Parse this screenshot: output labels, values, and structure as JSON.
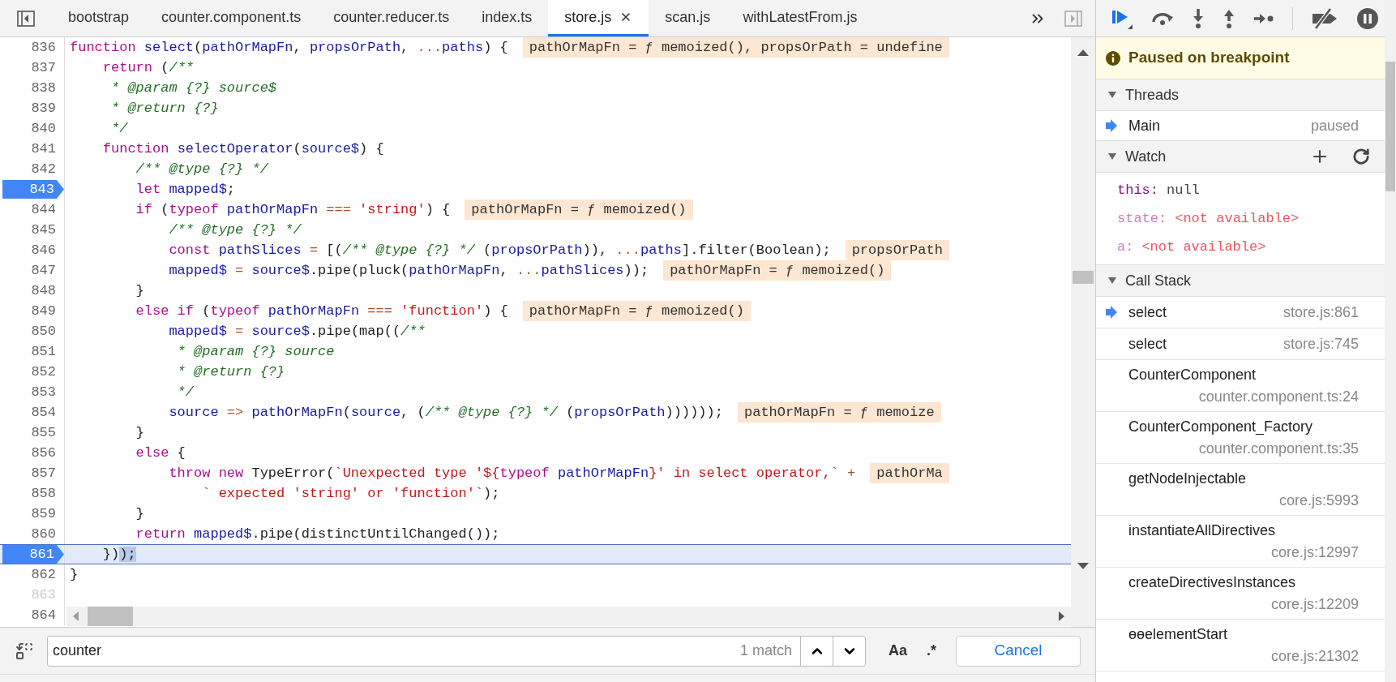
{
  "tabs": [
    {
      "label": "bootstrap",
      "selected": false,
      "closable": false
    },
    {
      "label": "counter.component.ts",
      "selected": false,
      "closable": false
    },
    {
      "label": "counter.reducer.ts",
      "selected": false,
      "closable": false
    },
    {
      "label": "index.ts",
      "selected": false,
      "closable": false
    },
    {
      "label": "store.js",
      "selected": true,
      "closable": true
    },
    {
      "label": "scan.js",
      "selected": false,
      "closable": false
    },
    {
      "label": "withLatestFrom.js",
      "selected": false,
      "closable": false
    }
  ],
  "code": [
    {
      "num": "836",
      "breakpoint": false,
      "current": false,
      "empty": false,
      "tokens": [
        {
          "kind": "keyword",
          "text": "function "
        },
        {
          "kind": "name",
          "text": "select"
        },
        {
          "kind": "plain",
          "text": "("
        },
        {
          "kind": "name",
          "text": "pathOrMapFn"
        },
        {
          "kind": "plain",
          "text": ", "
        },
        {
          "kind": "name",
          "text": "propsOrPath"
        },
        {
          "kind": "plain",
          "text": ", "
        },
        {
          "kind": "operator",
          "text": "..."
        },
        {
          "kind": "name",
          "text": "paths"
        },
        {
          "kind": "plain",
          "text": ") {"
        }
      ],
      "inline": "pathOrMapFn = ƒ memoized(), propsOrPath = undefine"
    },
    {
      "num": "837",
      "breakpoint": false,
      "current": false,
      "empty": false,
      "tokens": [
        {
          "kind": "keyword",
          "text": "    return"
        },
        {
          "kind": "plain",
          "text": " ("
        },
        {
          "kind": "comment",
          "text": "/**"
        }
      ]
    },
    {
      "num": "838",
      "breakpoint": false,
      "current": false,
      "empty": false,
      "tokens": [
        {
          "kind": "comment",
          "text": "     * @param {?} source$"
        }
      ]
    },
    {
      "num": "839",
      "breakpoint": false,
      "current": false,
      "empty": false,
      "tokens": [
        {
          "kind": "comment",
          "text": "     * @return {?}"
        }
      ]
    },
    {
      "num": "840",
      "breakpoint": false,
      "current": false,
      "empty": false,
      "tokens": [
        {
          "kind": "comment",
          "text": "     */"
        }
      ]
    },
    {
      "num": "841",
      "breakpoint": false,
      "current": false,
      "empty": false,
      "tokens": [
        {
          "kind": "keyword",
          "text": "    function "
        },
        {
          "kind": "name",
          "text": "selectOperator"
        },
        {
          "kind": "plain",
          "text": "("
        },
        {
          "kind": "name",
          "text": "source$"
        },
        {
          "kind": "plain",
          "text": ") {"
        }
      ]
    },
    {
      "num": "842",
      "breakpoint": false,
      "current": false,
      "empty": false,
      "tokens": [
        {
          "kind": "comment",
          "text": "        /** @type {?} */"
        }
      ]
    },
    {
      "num": "843",
      "breakpoint": true,
      "current": false,
      "empty": false,
      "tokens": [
        {
          "kind": "keyword",
          "text": "        let "
        },
        {
          "kind": "name",
          "text": "mapped$"
        },
        {
          "kind": "plain",
          "text": ";"
        }
      ]
    },
    {
      "num": "844",
      "breakpoint": false,
      "current": false,
      "empty": false,
      "tokens": [
        {
          "kind": "keyword",
          "text": "        if"
        },
        {
          "kind": "plain",
          "text": " ("
        },
        {
          "kind": "keyword",
          "text": "typeof "
        },
        {
          "kind": "name",
          "text": "pathOrMapFn"
        },
        {
          "kind": "operator",
          "text": " === "
        },
        {
          "kind": "string",
          "text": "'string'"
        },
        {
          "kind": "plain",
          "text": ") {"
        }
      ],
      "inline": "pathOrMapFn = ƒ memoized()"
    },
    {
      "num": "845",
      "breakpoint": false,
      "current": false,
      "empty": false,
      "tokens": [
        {
          "kind": "comment",
          "text": "            /** @type {?} */"
        }
      ]
    },
    {
      "num": "846",
      "breakpoint": false,
      "current": false,
      "empty": false,
      "tokens": [
        {
          "kind": "keyword",
          "text": "            const "
        },
        {
          "kind": "name",
          "text": "pathSlices"
        },
        {
          "kind": "operator",
          "text": " = "
        },
        {
          "kind": "plain",
          "text": "[("
        },
        {
          "kind": "comment",
          "text": "/** @type {?} */"
        },
        {
          "kind": "plain",
          "text": " ("
        },
        {
          "kind": "name",
          "text": "propsOrPath"
        },
        {
          "kind": "plain",
          "text": ")), "
        },
        {
          "kind": "operator",
          "text": "..."
        },
        {
          "kind": "name",
          "text": "paths"
        },
        {
          "kind": "plain",
          "text": "].filter(Boolean);"
        }
      ],
      "inline": "propsOrPath"
    },
    {
      "num": "847",
      "breakpoint": false,
      "current": false,
      "empty": false,
      "tokens": [
        {
          "kind": "name",
          "text": "            mapped$"
        },
        {
          "kind": "operator",
          "text": " = "
        },
        {
          "kind": "name",
          "text": "source$"
        },
        {
          "kind": "plain",
          "text": ".pipe(pluck("
        },
        {
          "kind": "name",
          "text": "pathOrMapFn"
        },
        {
          "kind": "plain",
          "text": ", "
        },
        {
          "kind": "operator",
          "text": "..."
        },
        {
          "kind": "name",
          "text": "pathSlices"
        },
        {
          "kind": "plain",
          "text": "));"
        }
      ],
      "inline": "pathOrMapFn = ƒ memoized()"
    },
    {
      "num": "848",
      "breakpoint": false,
      "current": false,
      "empty": false,
      "tokens": [
        {
          "kind": "plain",
          "text": "        }"
        }
      ]
    },
    {
      "num": "849",
      "breakpoint": false,
      "current": false,
      "empty": false,
      "tokens": [
        {
          "kind": "keyword",
          "text": "        else if"
        },
        {
          "kind": "plain",
          "text": " ("
        },
        {
          "kind": "keyword",
          "text": "typeof "
        },
        {
          "kind": "name",
          "text": "pathOrMapFn"
        },
        {
          "kind": "operator",
          "text": " === "
        },
        {
          "kind": "string",
          "text": "'function'"
        },
        {
          "kind": "plain",
          "text": ") {"
        }
      ],
      "inline": "pathOrMapFn = ƒ memoized()"
    },
    {
      "num": "850",
      "breakpoint": false,
      "current": false,
      "empty": false,
      "tokens": [
        {
          "kind": "name",
          "text": "            mapped$"
        },
        {
          "kind": "operator",
          "text": " = "
        },
        {
          "kind": "name",
          "text": "source$"
        },
        {
          "kind": "plain",
          "text": ".pipe(map(("
        },
        {
          "kind": "comment",
          "text": "/**"
        }
      ]
    },
    {
      "num": "851",
      "breakpoint": false,
      "current": false,
      "empty": false,
      "tokens": [
        {
          "kind": "comment",
          "text": "             * @param {?} source"
        }
      ]
    },
    {
      "num": "852",
      "breakpoint": false,
      "current": false,
      "empty": false,
      "tokens": [
        {
          "kind": "comment",
          "text": "             * @return {?}"
        }
      ]
    },
    {
      "num": "853",
      "breakpoint": false,
      "current": false,
      "empty": false,
      "tokens": [
        {
          "kind": "comment",
          "text": "             */"
        }
      ]
    },
    {
      "num": "854",
      "breakpoint": false,
      "current": false,
      "empty": false,
      "tokens": [
        {
          "kind": "name",
          "text": "            source"
        },
        {
          "kind": "operator",
          "text": " => "
        },
        {
          "kind": "name",
          "text": "pathOrMapFn"
        },
        {
          "kind": "plain",
          "text": "("
        },
        {
          "kind": "name",
          "text": "source"
        },
        {
          "kind": "plain",
          "text": ", ("
        },
        {
          "kind": "comment",
          "text": "/** @type {?} */"
        },
        {
          "kind": "plain",
          "text": " ("
        },
        {
          "kind": "name",
          "text": "propsOrPath"
        },
        {
          "kind": "plain",
          "text": "))))));"
        }
      ],
      "inline": "pathOrMapFn = ƒ memoize"
    },
    {
      "num": "855",
      "breakpoint": false,
      "current": false,
      "empty": false,
      "tokens": [
        {
          "kind": "plain",
          "text": "        }"
        }
      ]
    },
    {
      "num": "856",
      "breakpoint": false,
      "current": false,
      "empty": false,
      "tokens": [
        {
          "kind": "keyword",
          "text": "        else"
        },
        {
          "kind": "plain",
          "text": " {"
        }
      ]
    },
    {
      "num": "857",
      "breakpoint": false,
      "current": false,
      "empty": false,
      "tokens": [
        {
          "kind": "keyword",
          "text": "            throw new"
        },
        {
          "kind": "plain",
          "text": " TypeError("
        },
        {
          "kind": "string",
          "text": "`Unexpected type '${"
        },
        {
          "kind": "keyword",
          "text": "typeof "
        },
        {
          "kind": "name",
          "text": "pathOrMapFn"
        },
        {
          "kind": "string",
          "text": "}' in select operator,`"
        },
        {
          "kind": "operator",
          "text": " +"
        }
      ],
      "inline": "pathOrMa"
    },
    {
      "num": "858",
      "breakpoint": false,
      "current": false,
      "empty": false,
      "tokens": [
        {
          "kind": "string",
          "text": "                ` expected 'string' or 'function'`"
        },
        {
          "kind": "plain",
          "text": ");"
        }
      ]
    },
    {
      "num": "859",
      "breakpoint": false,
      "current": false,
      "empty": false,
      "tokens": [
        {
          "kind": "plain",
          "text": "        }"
        }
      ]
    },
    {
      "num": "860",
      "breakpoint": false,
      "current": false,
      "empty": false,
      "tokens": [
        {
          "kind": "keyword",
          "text": "        return "
        },
        {
          "kind": "name",
          "text": "mapped$"
        },
        {
          "kind": "plain",
          "text": ".pipe(distinctUntilChanged());"
        }
      ]
    },
    {
      "num": "861",
      "breakpoint": true,
      "current": true,
      "empty": false,
      "tokens": [
        {
          "kind": "plain",
          "text": "    })"
        },
        {
          "kind": "selected",
          "text": ");"
        }
      ]
    },
    {
      "num": "862",
      "breakpoint": false,
      "current": false,
      "empty": false,
      "tokens": [
        {
          "kind": "plain",
          "text": "}"
        }
      ]
    },
    {
      "num": "863",
      "breakpoint": false,
      "current": false,
      "empty": true
    },
    {
      "num": "864",
      "breakpoint": false,
      "current": false,
      "empty": false
    }
  ],
  "search": {
    "value": "counter",
    "match_count": "1 match",
    "case_toggle": "Aa",
    "regex_toggle": ".*",
    "cancel": "Cancel"
  },
  "banner": "Paused on breakpoint",
  "threads": {
    "title": "Threads",
    "expanded": true,
    "items": [
      {
        "name": "Main",
        "status": "paused",
        "selected": true
      }
    ]
  },
  "watch": {
    "title": "Watch",
    "expanded": true,
    "items": [
      {
        "name": "this:",
        "value": "null",
        "available": true
      },
      {
        "name": "state:",
        "value": "<not available>",
        "available": false
      },
      {
        "name": "a:",
        "value": "<not available>",
        "available": false
      }
    ]
  },
  "call_stack": {
    "title": "Call Stack",
    "expanded": true,
    "frames": [
      {
        "name": "select",
        "location": "store.js:861",
        "selected": true,
        "kind": "inline"
      },
      {
        "name": "select",
        "location": "store.js:745",
        "selected": false,
        "kind": "inline"
      },
      {
        "name": "CounterComponent",
        "location": "counter.component.ts:24",
        "selected": false,
        "kind": "wrapped"
      },
      {
        "name": "CounterComponent_Factory",
        "location": "counter.component.ts:35",
        "selected": false,
        "kind": "wrapped"
      },
      {
        "name": "getNodeInjectable",
        "location": "core.js:5993",
        "selected": false,
        "kind": "wrapped"
      },
      {
        "name": "instantiateAllDirectives",
        "location": "core.js:12997",
        "selected": false,
        "kind": "wrapped"
      },
      {
        "name": "createDirectivesInstances",
        "location": "core.js:12209",
        "selected": false,
        "kind": "wrapped"
      },
      {
        "name": "ɵɵelementStart",
        "location": "core.js:21302",
        "selected": false,
        "kind": "wrapped"
      }
    ]
  }
}
